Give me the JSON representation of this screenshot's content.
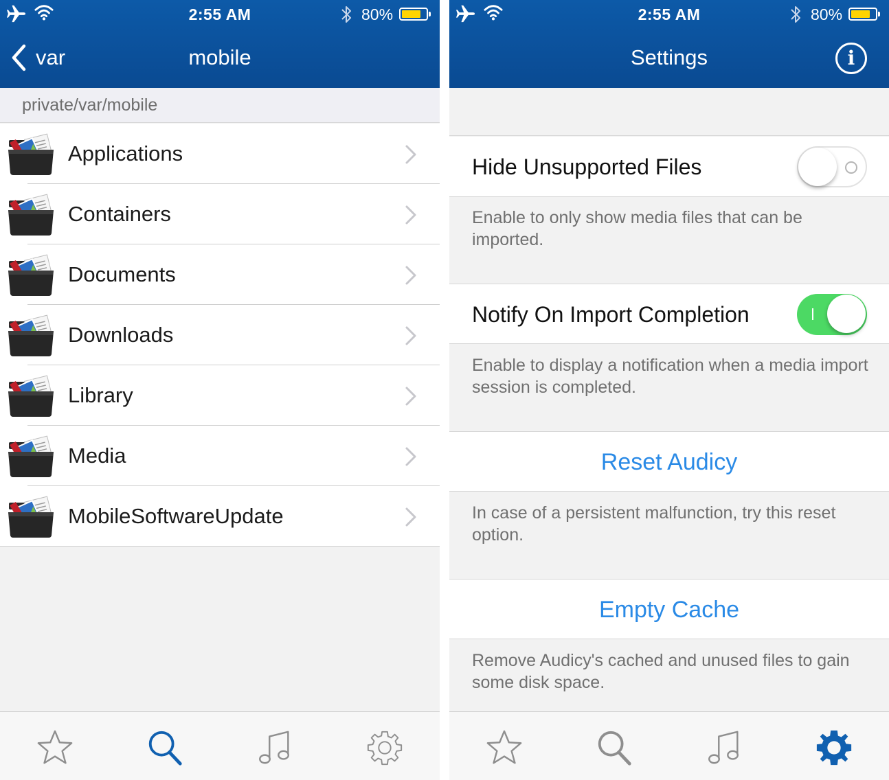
{
  "status_bar": {
    "time": "2:55 AM",
    "battery": "80%",
    "battery_level": 0.8,
    "battery_color": "#ffd400"
  },
  "browser": {
    "back_label": "var",
    "title": "mobile",
    "path": "private/var/mobile",
    "folders": [
      "Applications",
      "Containers",
      "Documents",
      "Downloads",
      "Library",
      "Media",
      "MobileSoftwareUpdate"
    ]
  },
  "settings": {
    "title": "Settings",
    "hide_unsupported": {
      "label": "Hide Unsupported Files",
      "enabled": false,
      "note": "Enable to only show media files that can be imported."
    },
    "notify_import": {
      "label": "Notify On Import Completion",
      "enabled": true,
      "note": "Enable to display a notification when a media import session is completed."
    },
    "reset": {
      "label": "Reset Audicy",
      "note": "In case of a persistent malfunction, try this reset option."
    },
    "empty_cache": {
      "label": "Empty Cache",
      "note": "Remove Audicy's cached and unused files to gain some disk space."
    }
  },
  "tabs": [
    "star-icon",
    "search-icon",
    "music-note-icon",
    "gear-icon"
  ],
  "colors": {
    "nav_bar": "#0a4a92",
    "accent": "#2a8ae6",
    "tab_active": "#1060b0",
    "tab_inactive": "#8e8e8e",
    "switch_on": "#4cd964"
  }
}
